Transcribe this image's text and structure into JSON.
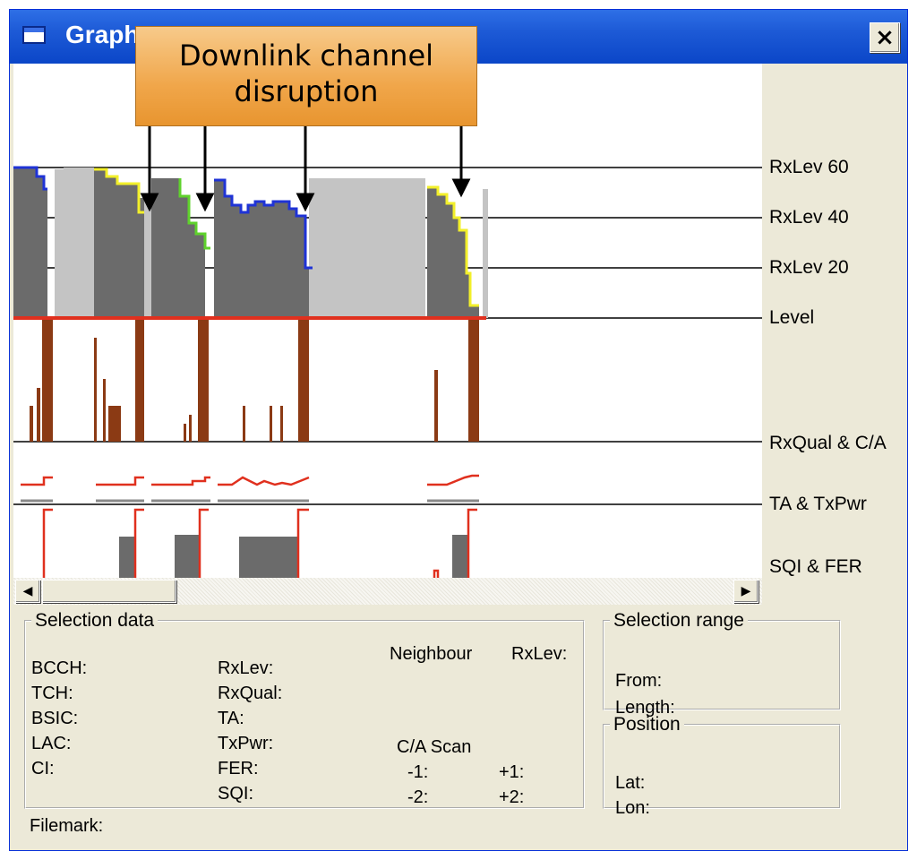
{
  "window": {
    "title": "Graph",
    "close_glyph": "×",
    "close_icon": "close-icon"
  },
  "callout": {
    "line1": "Downlink channel",
    "line2": "disruption"
  },
  "channels": {
    "rxlev60": "RxLev 60",
    "rxlev40": "RxLev 40",
    "rxlev20": "RxLev 20",
    "level": "Level",
    "rxqual_ca": "RxQual & C/A",
    "ta_txpwr": "TA & TxPwr",
    "sqi_fer": "SQI & FER"
  },
  "scrollbar": {
    "left_glyph": "◀",
    "right_glyph": "▶"
  },
  "selection_data": {
    "legend": "Selection data",
    "bcch": "BCCH:",
    "tch": "TCH:",
    "bsic": "BSIC:",
    "lac": "LAC:",
    "ci": "CI:",
    "rxlev": "RxLev:",
    "rxqual": "RxQual:",
    "ta": "TA:",
    "txpwr": "TxPwr:",
    "fer": "FER:",
    "sqi": "SQI:",
    "neighbour": "Neighbour",
    "neighbour_rxlev": "RxLev:",
    "ca_scan": "C/A Scan",
    "m1": "-1:",
    "p1": "+1:",
    "m2": "-2:",
    "p2": "+2:"
  },
  "selection_range": {
    "legend": "Selection range",
    "from": "From:",
    "length": "Length:"
  },
  "position": {
    "legend": "Position",
    "lat": "Lat:",
    "lon": "Lon:"
  },
  "filemark": "Filemark:",
  "colors": {
    "dark_gray": "#6b6b6b",
    "light_gray": "#c4c4c4",
    "blue": "#1f33d6",
    "yellow": "#f2ef2a",
    "green": "#5fd22c",
    "red": "#e0301e",
    "brown": "#8b3a14",
    "arrow": "#000000"
  }
}
